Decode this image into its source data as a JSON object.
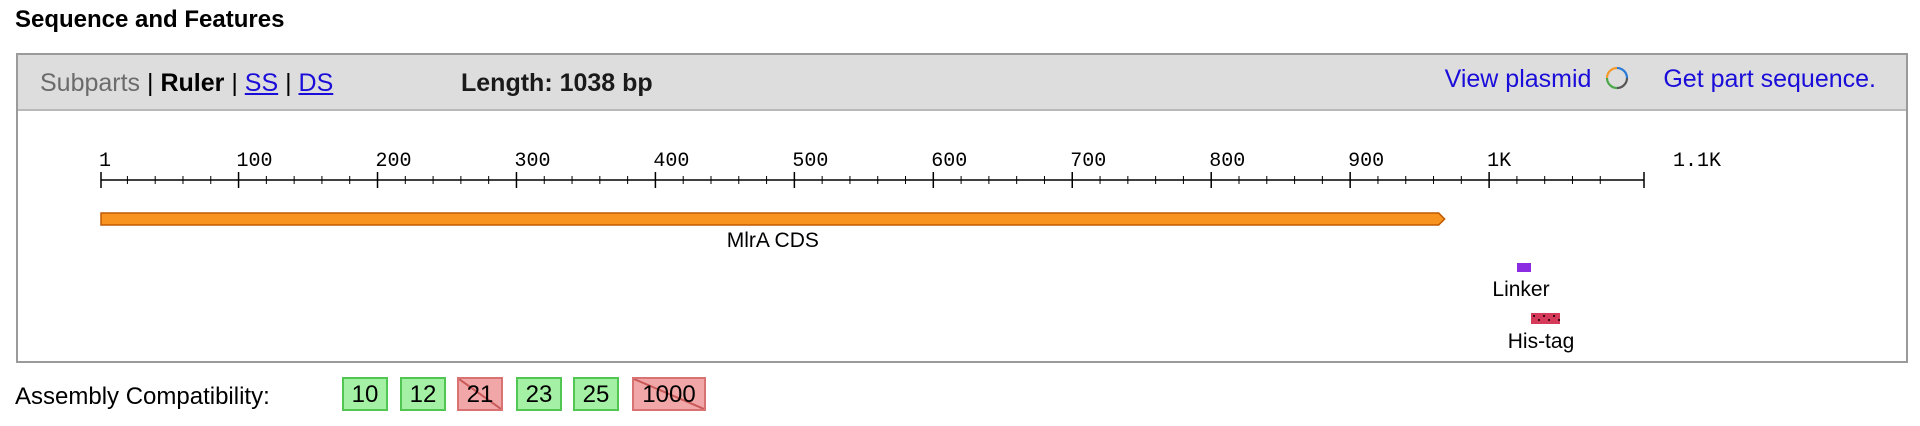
{
  "section_title": "Sequence and Features",
  "toolbar": {
    "subparts_label": "Subparts",
    "separator": "|",
    "ruler_label": "Ruler",
    "ss_label": "SS",
    "ds_label": "DS",
    "length_text": "Length: 1038 bp",
    "view_plasmid_label": "View plasmid",
    "get_sequence_label": "Get part sequence."
  },
  "ruler": {
    "ticks": [
      "1",
      "100",
      "200",
      "300",
      "400",
      "500",
      "600",
      "700",
      "800",
      "900",
      "1K",
      "1.1K"
    ],
    "sequence_length_bp": 1038
  },
  "features": [
    {
      "name": "MlrA CDS",
      "start": 1,
      "end": 968,
      "type": "cds",
      "color": "#f7931e"
    },
    {
      "name": "Linker",
      "start": 970,
      "end": 979,
      "type": "linker",
      "color": "#8b2be2"
    },
    {
      "name": "His-tag",
      "start": 985,
      "end": 1005,
      "type": "tag",
      "color": "#d63a5b"
    }
  ],
  "assembly": {
    "label": "Assembly Compatibility:",
    "standards": [
      {
        "name": "10",
        "compatible": true
      },
      {
        "name": "12",
        "compatible": true
      },
      {
        "name": "21",
        "compatible": false
      },
      {
        "name": "23",
        "compatible": true
      },
      {
        "name": "25",
        "compatible": true
      },
      {
        "name": "1000",
        "compatible": false
      }
    ]
  },
  "colors": {
    "link": "#1a0dd9",
    "compatible_bg": "#a4f0a4",
    "incompatible_bg": "#f1a7a7",
    "cds": "#f7931e",
    "linker": "#8b2be2",
    "his_tag": "#d63a5b"
  }
}
